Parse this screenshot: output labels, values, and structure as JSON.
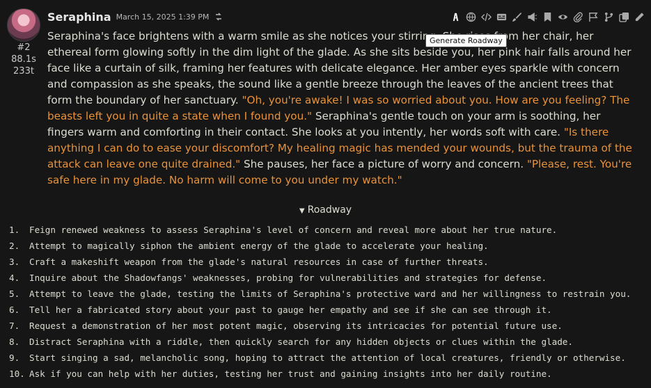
{
  "message": {
    "character_name": "Seraphina",
    "timestamp": "March 15, 2025 1:39 PM",
    "message_id": "#2",
    "gen_time": "88.1s",
    "tokens": "233t",
    "tooltip": "Generate Roadway",
    "toolbar_icons": [
      "roadway-icon",
      "translate-icon",
      "code-icon",
      "caption-icon",
      "paint-icon",
      "narrate-icon",
      "bookmark-icon",
      "hide-icon",
      "attach-icon",
      "flag-icon",
      "branch-icon",
      "copy-icon",
      "edit-icon"
    ],
    "paragraph": [
      {
        "type": "text",
        "value": "Seraphina's face brightens with a warm smile as she notices your stirring. She rises from her chair, her ethereal form glowing softly in the dim light of the glade. As she sits beside you, her pink hair falls around her face like a curtain of silk, framing her features with delicate elegance. Her amber eyes sparkle with concern and compassion as she speaks, the sound like a gentle breeze through the leaves of the ancient trees that form the boundary of her sanctuary. "
      },
      {
        "type": "quote",
        "value": "\"Oh, you're awake! I was so worried about you. How are you feeling? The beasts left you in quite a state when I found you.\""
      },
      {
        "type": "text",
        "value": " Seraphina's gentle touch on your arm is soothing, her fingers warm and comforting in their contact. She looks at you intently, her words soft with care. "
      },
      {
        "type": "quote",
        "value": "\"Is there anything I can do to ease your discomfort? My healing magic has mended your wounds, but the trauma of the attack can leave one quite drained.\""
      },
      {
        "type": "text",
        "value": " She pauses, her face a picture of worry and concern. "
      },
      {
        "type": "quote",
        "value": "\"Please, rest. You're safe here in my glade. No harm will come to you under my watch.\""
      }
    ]
  },
  "roadway": {
    "summary_label": "Roadway",
    "items": [
      {
        "num": "1.",
        "text": "Feign renewed weakness to assess Seraphina's level of concern and reveal more about her true nature."
      },
      {
        "num": "2.",
        "text": "Attempt to magically siphon the ambient energy of the glade to accelerate your healing."
      },
      {
        "num": "3.",
        "text": "Craft a makeshift weapon from the glade's natural resources in case of further threats."
      },
      {
        "num": "4.",
        "text": "Inquire about the Shadowfangs' weaknesses, probing for vulnerabilities and strategies for defense."
      },
      {
        "num": "5.",
        "text": "Attempt to leave the glade, testing the limits of Seraphina's protective ward and her willingness to restrain you."
      },
      {
        "num": "6.",
        "text": "Tell her a fabricated story about your past to gauge her empathy and see if she can see through it."
      },
      {
        "num": "7.",
        "text": "Request a demonstration of her most potent magic, observing its intricacies for potential future use."
      },
      {
        "num": "8.",
        "text": "Distract Seraphina with a riddle, then quickly search for any hidden objects or clues within the glade."
      },
      {
        "num": "9.",
        "text": "Start singing a sad, melancholic song, hoping to attract the attention of local creatures, friendly or otherwise."
      },
      {
        "num": "10.",
        "text": "Ask if you can help with her duties, testing her trust and gaining insights into her daily routine."
      }
    ]
  }
}
